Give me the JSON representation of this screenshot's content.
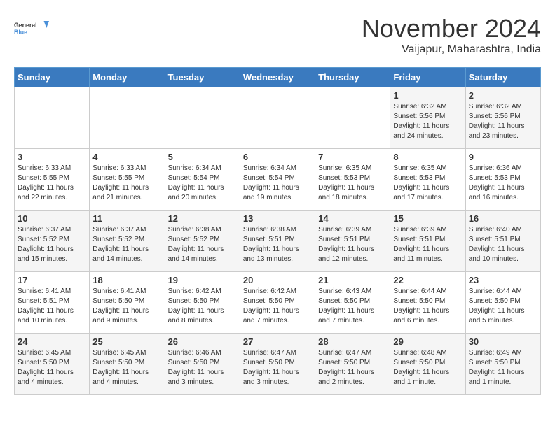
{
  "logo": {
    "line1": "General",
    "line2": "Blue"
  },
  "title": "November 2024",
  "location": "Vaijapur, Maharashtra, India",
  "days_of_week": [
    "Sunday",
    "Monday",
    "Tuesday",
    "Wednesday",
    "Thursday",
    "Friday",
    "Saturday"
  ],
  "weeks": [
    [
      {
        "day": "",
        "info": ""
      },
      {
        "day": "",
        "info": ""
      },
      {
        "day": "",
        "info": ""
      },
      {
        "day": "",
        "info": ""
      },
      {
        "day": "",
        "info": ""
      },
      {
        "day": "1",
        "info": "Sunrise: 6:32 AM\nSunset: 5:56 PM\nDaylight: 11 hours and 24 minutes."
      },
      {
        "day": "2",
        "info": "Sunrise: 6:32 AM\nSunset: 5:56 PM\nDaylight: 11 hours and 23 minutes."
      }
    ],
    [
      {
        "day": "3",
        "info": "Sunrise: 6:33 AM\nSunset: 5:55 PM\nDaylight: 11 hours and 22 minutes."
      },
      {
        "day": "4",
        "info": "Sunrise: 6:33 AM\nSunset: 5:55 PM\nDaylight: 11 hours and 21 minutes."
      },
      {
        "day": "5",
        "info": "Sunrise: 6:34 AM\nSunset: 5:54 PM\nDaylight: 11 hours and 20 minutes."
      },
      {
        "day": "6",
        "info": "Sunrise: 6:34 AM\nSunset: 5:54 PM\nDaylight: 11 hours and 19 minutes."
      },
      {
        "day": "7",
        "info": "Sunrise: 6:35 AM\nSunset: 5:53 PM\nDaylight: 11 hours and 18 minutes."
      },
      {
        "day": "8",
        "info": "Sunrise: 6:35 AM\nSunset: 5:53 PM\nDaylight: 11 hours and 17 minutes."
      },
      {
        "day": "9",
        "info": "Sunrise: 6:36 AM\nSunset: 5:53 PM\nDaylight: 11 hours and 16 minutes."
      }
    ],
    [
      {
        "day": "10",
        "info": "Sunrise: 6:37 AM\nSunset: 5:52 PM\nDaylight: 11 hours and 15 minutes."
      },
      {
        "day": "11",
        "info": "Sunrise: 6:37 AM\nSunset: 5:52 PM\nDaylight: 11 hours and 14 minutes."
      },
      {
        "day": "12",
        "info": "Sunrise: 6:38 AM\nSunset: 5:52 PM\nDaylight: 11 hours and 14 minutes."
      },
      {
        "day": "13",
        "info": "Sunrise: 6:38 AM\nSunset: 5:51 PM\nDaylight: 11 hours and 13 minutes."
      },
      {
        "day": "14",
        "info": "Sunrise: 6:39 AM\nSunset: 5:51 PM\nDaylight: 11 hours and 12 minutes."
      },
      {
        "day": "15",
        "info": "Sunrise: 6:39 AM\nSunset: 5:51 PM\nDaylight: 11 hours and 11 minutes."
      },
      {
        "day": "16",
        "info": "Sunrise: 6:40 AM\nSunset: 5:51 PM\nDaylight: 11 hours and 10 minutes."
      }
    ],
    [
      {
        "day": "17",
        "info": "Sunrise: 6:41 AM\nSunset: 5:51 PM\nDaylight: 11 hours and 10 minutes."
      },
      {
        "day": "18",
        "info": "Sunrise: 6:41 AM\nSunset: 5:50 PM\nDaylight: 11 hours and 9 minutes."
      },
      {
        "day": "19",
        "info": "Sunrise: 6:42 AM\nSunset: 5:50 PM\nDaylight: 11 hours and 8 minutes."
      },
      {
        "day": "20",
        "info": "Sunrise: 6:42 AM\nSunset: 5:50 PM\nDaylight: 11 hours and 7 minutes."
      },
      {
        "day": "21",
        "info": "Sunrise: 6:43 AM\nSunset: 5:50 PM\nDaylight: 11 hours and 7 minutes."
      },
      {
        "day": "22",
        "info": "Sunrise: 6:44 AM\nSunset: 5:50 PM\nDaylight: 11 hours and 6 minutes."
      },
      {
        "day": "23",
        "info": "Sunrise: 6:44 AM\nSunset: 5:50 PM\nDaylight: 11 hours and 5 minutes."
      }
    ],
    [
      {
        "day": "24",
        "info": "Sunrise: 6:45 AM\nSunset: 5:50 PM\nDaylight: 11 hours and 4 minutes."
      },
      {
        "day": "25",
        "info": "Sunrise: 6:45 AM\nSunset: 5:50 PM\nDaylight: 11 hours and 4 minutes."
      },
      {
        "day": "26",
        "info": "Sunrise: 6:46 AM\nSunset: 5:50 PM\nDaylight: 11 hours and 3 minutes."
      },
      {
        "day": "27",
        "info": "Sunrise: 6:47 AM\nSunset: 5:50 PM\nDaylight: 11 hours and 3 minutes."
      },
      {
        "day": "28",
        "info": "Sunrise: 6:47 AM\nSunset: 5:50 PM\nDaylight: 11 hours and 2 minutes."
      },
      {
        "day": "29",
        "info": "Sunrise: 6:48 AM\nSunset: 5:50 PM\nDaylight: 11 hours and 1 minute."
      },
      {
        "day": "30",
        "info": "Sunrise: 6:49 AM\nSunset: 5:50 PM\nDaylight: 11 hours and 1 minute."
      }
    ]
  ]
}
